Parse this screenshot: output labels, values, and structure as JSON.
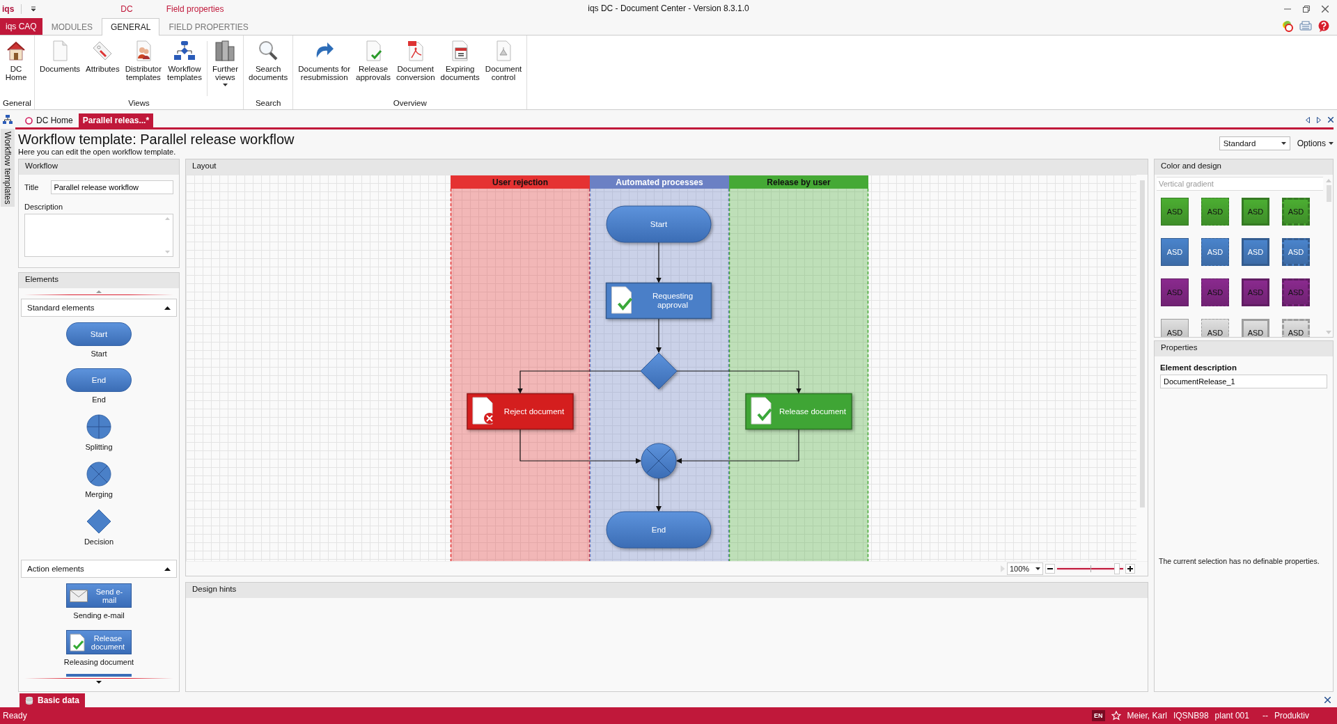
{
  "app": {
    "logo": "iqs",
    "context_tabs": [
      "DC",
      "Field properties"
    ],
    "title": "iqs DC - Document Center - Version 8.3.1.0"
  },
  "app_button": "iqs CAQ",
  "ribbon_tabs": [
    {
      "label": "MODULES",
      "selected": false
    },
    {
      "label": "GENERAL",
      "selected": true
    },
    {
      "label": "FIELD PROPERTIES",
      "selected": false
    }
  ],
  "ribbon_groups": [
    {
      "label": "General",
      "items": [
        {
          "label": "DC\nHome"
        }
      ]
    },
    {
      "label": "Views",
      "items": [
        {
          "label": "Documents"
        },
        {
          "label": "Attributes"
        },
        {
          "label": "Distributor\ntemplates"
        },
        {
          "label": "Workflow\ntemplates"
        },
        {
          "label": "Further\nviews",
          "kind": "menu"
        }
      ]
    },
    {
      "label": "Search",
      "items": [
        {
          "label": "Search\ndocuments"
        }
      ]
    },
    {
      "label": "Overview",
      "items": [
        {
          "label": "Documents for\nresubmission"
        },
        {
          "label": "Release\napprovals"
        },
        {
          "label": "Document\nconversion"
        },
        {
          "label": "Expiring\ndocuments"
        },
        {
          "label": "Document\ncontrol"
        }
      ]
    }
  ],
  "side_tab": "Workflow templates",
  "doc_tabs": [
    {
      "label": "DC Home",
      "selected": false
    },
    {
      "label": "Parallel releas...*",
      "selected": true
    }
  ],
  "heading": "Workflow template: Parallel release workflow",
  "subheading": "Here you can edit the open workflow template.",
  "view_select": "Standard",
  "options_menu": "Options",
  "workflow_panel": {
    "title": "Workflow",
    "title_label": "Title",
    "title_value": "Parallel release workflow",
    "description_label": "Description"
  },
  "elements_panel": {
    "title": "Elements",
    "groups": [
      {
        "label": "Standard elements",
        "expanded": true,
        "items": [
          {
            "kind": "start",
            "shape_label": "Start",
            "caption": "Start"
          },
          {
            "kind": "end",
            "shape_label": "End",
            "caption": "End"
          },
          {
            "kind": "split",
            "caption": "Splitting"
          },
          {
            "kind": "merge",
            "caption": "Merging"
          },
          {
            "kind": "decision",
            "caption": "Decision"
          }
        ]
      },
      {
        "label": "Action elements",
        "expanded": true,
        "items": [
          {
            "kind": "email",
            "shape_label": "Send e-mail",
            "caption": "Sending e-mail"
          },
          {
            "kind": "release",
            "shape_label": "Release document",
            "caption": "Releasing document"
          }
        ]
      }
    ]
  },
  "layout_panel": {
    "title": "Layout",
    "lanes": [
      {
        "label": "User rejection",
        "color": "#e53232"
      },
      {
        "label": "Automated processes",
        "color": "#6b80c4"
      },
      {
        "label": "Release by user",
        "color": "#45a935"
      }
    ],
    "nodes": [
      {
        "kind": "start",
        "label": "Start"
      },
      {
        "kind": "approval",
        "label": "Requesting approval"
      },
      {
        "kind": "decision"
      },
      {
        "kind": "rejection",
        "label": "Reject document"
      },
      {
        "kind": "release",
        "label": "Release document"
      },
      {
        "kind": "merge"
      },
      {
        "kind": "end",
        "label": "End"
      }
    ],
    "zoom": {
      "value": "100%",
      "level": 0.9
    }
  },
  "design_hints": {
    "title": "Design hints"
  },
  "color_panel": {
    "title": "Color and design",
    "section": "Vertical gradient",
    "swatches": [
      {
        "label": "ASD",
        "color": "#4cae32",
        "kind": "solid"
      },
      {
        "label": "ASD",
        "color": "#4cae32",
        "kind": "dashed"
      },
      {
        "label": "ASD",
        "color": "#4cae32",
        "kind": "thick"
      },
      {
        "label": "ASD",
        "color": "#4cae32",
        "kind": "thick-dashed"
      },
      {
        "label": "ASD",
        "color": "#4a84cc",
        "kind": "solid"
      },
      {
        "label": "ASD",
        "color": "#4a84cc",
        "kind": "dashed"
      },
      {
        "label": "ASD",
        "color": "#4a84cc",
        "kind": "thick"
      },
      {
        "label": "ASD",
        "color": "#4a84cc",
        "kind": "thick-dashed"
      },
      {
        "label": "ASD",
        "color": "#8a2a8e",
        "kind": "solid"
      },
      {
        "label": "ASD",
        "color": "#8a2a8e",
        "kind": "dashed"
      },
      {
        "label": "ASD",
        "color": "#8a2a8e",
        "kind": "thick"
      },
      {
        "label": "ASD",
        "color": "#8a2a8e",
        "kind": "thick-dashed"
      },
      {
        "label": "ASD",
        "color": "#e0e0e0",
        "kind": "solid"
      },
      {
        "label": "ASD",
        "color": "#e0e0e0",
        "kind": "dashed"
      },
      {
        "label": "ASD",
        "color": "#e0e0e0",
        "kind": "thick"
      },
      {
        "label": "ASD",
        "color": "#e0e0e0",
        "kind": "thick-dashed"
      }
    ]
  },
  "properties_panel": {
    "title": "Properties",
    "field_label": "Element description",
    "field_value": "DocumentRelease_1",
    "note": "The current selection has no definable properties."
  },
  "bottom_tab": "Basic data",
  "status_bar": {
    "text": "Ready",
    "language": "EN",
    "user": "Meier, Karl",
    "host": "IQSNB98",
    "plant": "plant 001",
    "separator": "--",
    "environment": "Produktiv"
  }
}
